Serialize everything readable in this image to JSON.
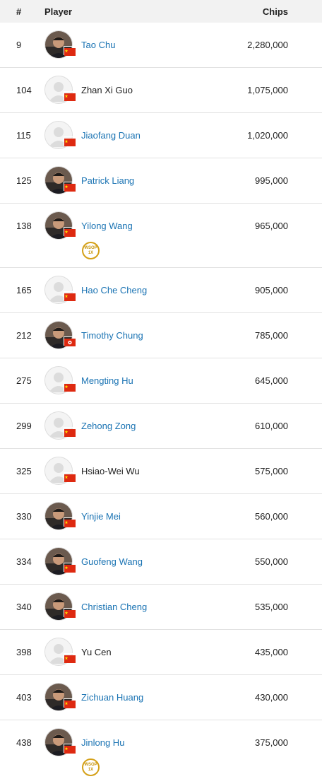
{
  "header": {
    "rank": "#",
    "player": "Player",
    "chips": "Chips"
  },
  "colors": {
    "link": "#1a73b3",
    "badge": "#d4a017",
    "cn_flag": "#de2910",
    "hk_flag": "#de2910"
  },
  "rows": [
    {
      "rank": "9",
      "name": "Tao Chu",
      "chips": "2,280,000",
      "link": true,
      "flag": "china-flag-icon",
      "photo": true
    },
    {
      "rank": "104",
      "name": "Zhan Xi Guo",
      "chips": "1,075,000",
      "link": false,
      "flag": "china-flag-icon",
      "photo": false
    },
    {
      "rank": "115",
      "name": "Jiaofang Duan",
      "chips": "1,020,000",
      "link": true,
      "flag": "china-flag-icon",
      "photo": false
    },
    {
      "rank": "125",
      "name": "Patrick Liang",
      "chips": "995,000",
      "link": true,
      "flag": "china-flag-icon",
      "photo": true
    },
    {
      "rank": "138",
      "name": "Yilong Wang",
      "chips": "965,000",
      "link": true,
      "flag": "china-flag-icon",
      "photo": true,
      "badge": {
        "line1": "WSOP",
        "line2": "1X"
      }
    },
    {
      "rank": "165",
      "name": "Hao Che Cheng",
      "chips": "905,000",
      "link": true,
      "flag": "china-flag-icon",
      "photo": false
    },
    {
      "rank": "212",
      "name": "Timothy Chung",
      "chips": "785,000",
      "link": true,
      "flag": "hong-kong-flag-icon",
      "photo": true
    },
    {
      "rank": "275",
      "name": "Mengting Hu",
      "chips": "645,000",
      "link": true,
      "flag": "china-flag-icon",
      "photo": false
    },
    {
      "rank": "299",
      "name": "Zehong Zong",
      "chips": "610,000",
      "link": true,
      "flag": "china-flag-icon",
      "photo": false
    },
    {
      "rank": "325",
      "name": "Hsiao-Wei Wu",
      "chips": "575,000",
      "link": false,
      "flag": "china-flag-icon",
      "photo": false
    },
    {
      "rank": "330",
      "name": "Yinjie Mei",
      "chips": "560,000",
      "link": true,
      "flag": "china-flag-icon",
      "photo": true
    },
    {
      "rank": "334",
      "name": "Guofeng Wang",
      "chips": "550,000",
      "link": true,
      "flag": "china-flag-icon",
      "photo": true
    },
    {
      "rank": "340",
      "name": "Christian Cheng",
      "chips": "535,000",
      "link": true,
      "flag": "china-flag-icon",
      "photo": true
    },
    {
      "rank": "398",
      "name": "Yu Cen",
      "chips": "435,000",
      "link": false,
      "flag": "china-flag-icon",
      "photo": false
    },
    {
      "rank": "403",
      "name": "Zichuan Huang",
      "chips": "430,000",
      "link": true,
      "flag": "china-flag-icon",
      "photo": true
    },
    {
      "rank": "438",
      "name": "Jinlong Hu",
      "chips": "375,000",
      "link": true,
      "flag": "china-flag-icon",
      "photo": true,
      "badge": {
        "line1": "WSOP",
        "line2": "1X"
      }
    }
  ]
}
